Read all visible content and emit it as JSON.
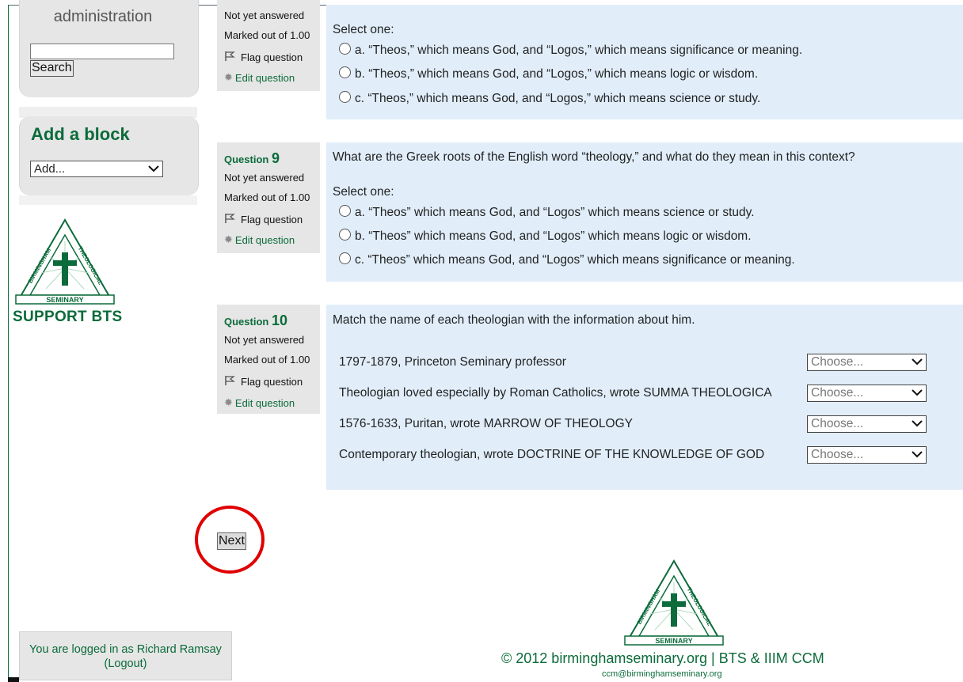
{
  "sidebar": {
    "admin_title": "administration",
    "search_button": "Search",
    "add_block_title": "Add a block",
    "add_select_value": "Add...",
    "support_label": "SUPPORT BTS",
    "logo_top_text": "BIRMINGHAM",
    "logo_right_text": "THEOLOGICAL",
    "logo_bottom_text": "SEMINARY"
  },
  "questions": [
    {
      "status": "Not yet answered",
      "marks": "Marked out of 1.00",
      "flag_label": "Flag question",
      "edit_label": "Edit question",
      "select_one": "Select one:",
      "options": [
        "a. “Theos,” which means God, and “Logos,” which means significance or meaning.",
        "b. “Theos,” which means God, and “Logos,” which means logic or wisdom.",
        "c. “Theos,” which means God, and “Logos,” which means science or study."
      ]
    },
    {
      "label": "Question",
      "number": "9",
      "status": "Not yet answered",
      "marks": "Marked out of 1.00",
      "flag_label": "Flag question",
      "edit_label": "Edit question",
      "text": "What are the Greek roots of the English word “theology,” and what do they mean in this context?",
      "select_one": "Select one:",
      "options": [
        "a. “Theos” which means God, and “Logos” which means science or study.",
        "b. “Theos” which means God, and “Logos” which means logic or wisdom.",
        "c. “Theos” which means God, and “Logos” which means significance or meaning."
      ]
    },
    {
      "label": "Question",
      "number": "10",
      "status": "Not yet answered",
      "marks": "Marked out of 1.00",
      "flag_label": "Flag question",
      "edit_label": "Edit question",
      "text": "Match the name of each theologian with the information about him.",
      "matches": [
        {
          "prompt": "1797-1879, Princeton Seminary professor",
          "choice": "Choose..."
        },
        {
          "prompt": "Theologian loved especially by Roman Catholics, wrote SUMMA THEOLOGICA",
          "choice": "Choose..."
        },
        {
          "prompt": "1576-1633, Puritan, wrote MARROW OF THEOLOGY",
          "choice": "Choose..."
        },
        {
          "prompt": "Contemporary theologian, wrote DOCTRINE OF THE KNOWLEDGE OF GOD",
          "choice": "Choose..."
        }
      ]
    }
  ],
  "next_button": "Next",
  "login": {
    "prefix": "You are logged in as",
    "user": "Richard Ramsay",
    "logout": "(Logout)"
  },
  "footer": {
    "copyright": "© 2012 birminghamseminary.org | BTS & IIIM CCM",
    "email": "ccm@birminghamseminary.org"
  },
  "colors": {
    "brand_green": "#0b6b3a",
    "question_bg": "#e1eefa",
    "info_bg": "#e6e6e6",
    "highlight_red": "#e00000"
  }
}
